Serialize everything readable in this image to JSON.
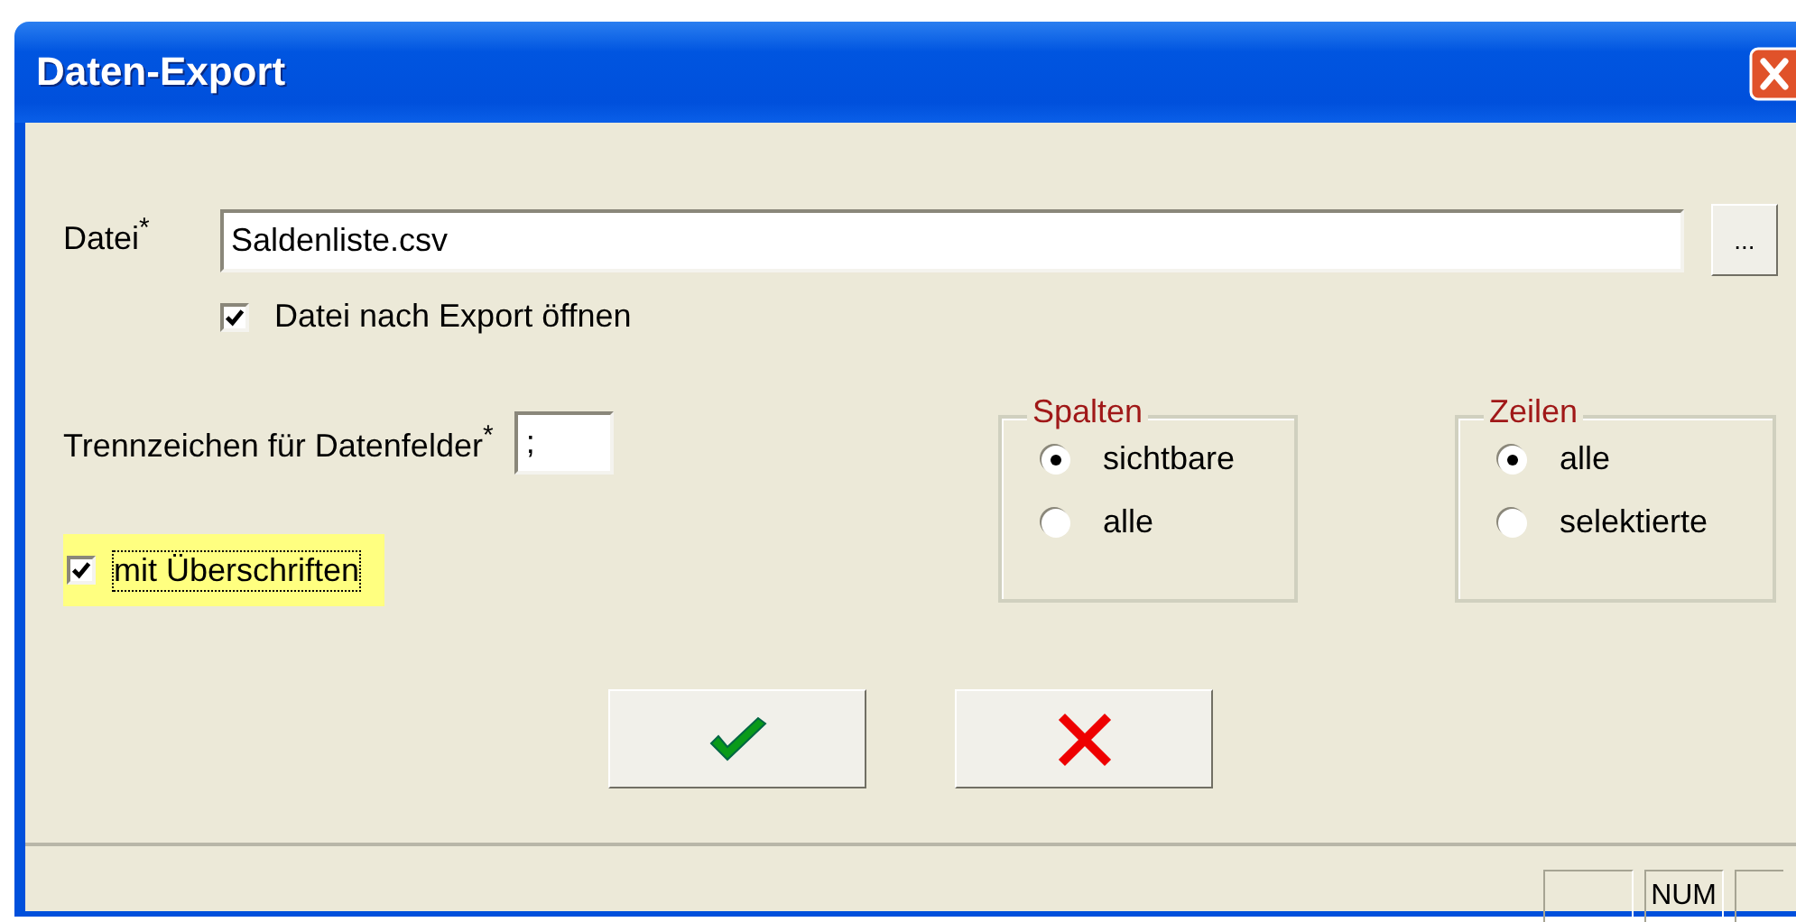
{
  "window": {
    "title": "Daten-Export"
  },
  "file": {
    "label": "Datei$^{*}$",
    "value": "Saldenliste.csv",
    "browse": "..."
  },
  "open_after_export": {
    "label": "Datei nach Export öffnen",
    "checked": true
  },
  "separator": {
    "label": "Trennzeichen für Datenfelder$^{*}$",
    "value": ";"
  },
  "with_headers": {
    "label": "mit Überschriften",
    "checked": true,
    "focused": true
  },
  "groups": [
    {
      "title": "Spalten",
      "options": [
        {
          "label": "sichtbare",
          "selected": true
        },
        {
          "label": "alle",
          "selected": false
        }
      ]
    },
    {
      "title": "Zeilen",
      "options": [
        {
          "label": "alle",
          "selected": true
        },
        {
          "label": "selektierte",
          "selected": false
        }
      ]
    }
  ],
  "buttons": [
    {
      "kind": "ok"
    },
    {
      "kind": "cancel"
    }
  ],
  "status_bar": {
    "indicator": "NUM"
  }
}
